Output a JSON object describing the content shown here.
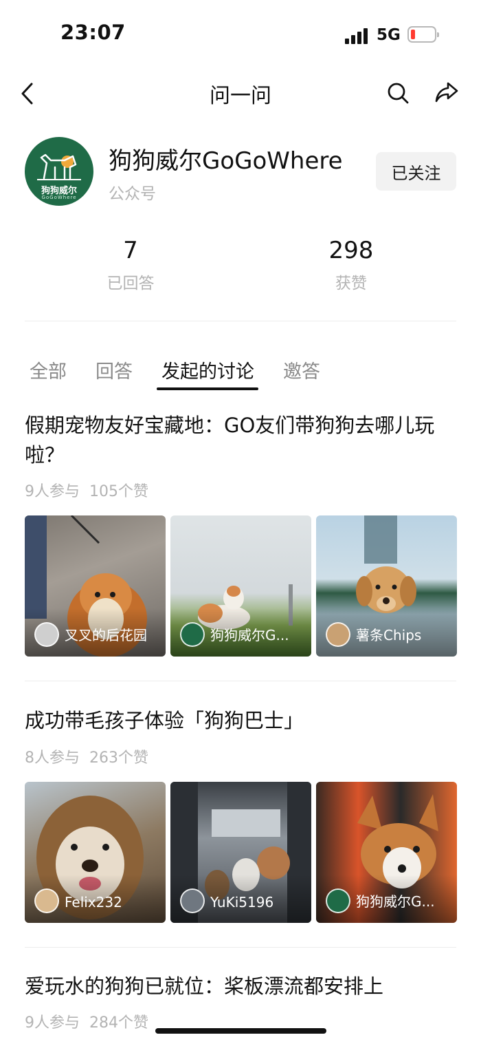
{
  "status_bar": {
    "time": "23:07",
    "network": "5G",
    "battery_color": "#ff3b30"
  },
  "nav": {
    "title": "问一问",
    "back_icon": "chevron-left-icon",
    "search_icon": "search-icon",
    "share_icon": "share-icon"
  },
  "profile": {
    "name": "狗狗威尔GoGoWhere",
    "type": "公众号",
    "follow_label": "已关注",
    "avatar_line1": "狗狗威尔",
    "avatar_line2": "GoGoWhere",
    "avatar_color": "#1f6b47"
  },
  "stats": [
    {
      "value": "7",
      "label": "已回答"
    },
    {
      "value": "298",
      "label": "获赞"
    }
  ],
  "tabs": [
    {
      "label": "全部",
      "active": false
    },
    {
      "label": "回答",
      "active": false
    },
    {
      "label": "发起的讨论",
      "active": true
    },
    {
      "label": "邀答",
      "active": false
    }
  ],
  "posts": [
    {
      "title": "假期宠物友好宝藏地：GO友们带狗狗去哪儿玩啦？",
      "participants": "9人参与",
      "likes": "105个赞",
      "images": [
        {
          "user": "叉叉的后花园"
        },
        {
          "user": "狗狗威尔G..."
        },
        {
          "user": "薯条Chips"
        }
      ]
    },
    {
      "title": "成功带毛孩子体验「狗狗巴士」",
      "participants": "8人参与",
      "likes": "263个赞",
      "images": [
        {
          "user": "Felix232"
        },
        {
          "user": "YuKi5196"
        },
        {
          "user": "狗狗威尔G..."
        }
      ]
    },
    {
      "title": "爱玩水的狗狗已就位：桨板漂流都安排上",
      "participants": "9人参与",
      "likes": "284个赞"
    }
  ]
}
